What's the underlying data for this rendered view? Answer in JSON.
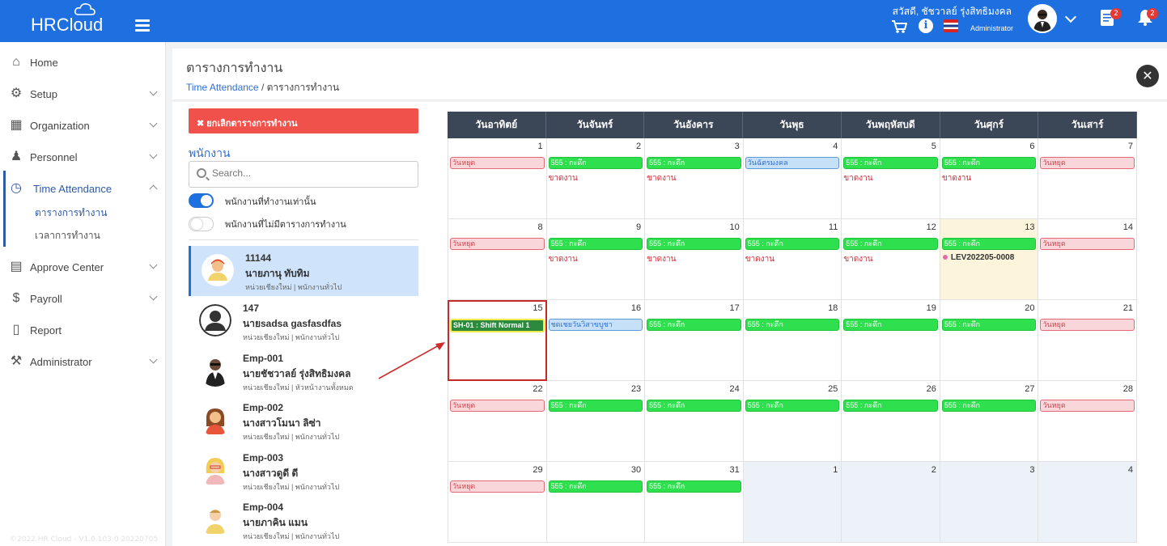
{
  "app": {
    "brand": "HRCloud",
    "greeting": "สวัสดี, ชัชวาลย์ รุ่งสิทธิมงคล",
    "role": "Administrator",
    "doc_badge": "2",
    "bell_badge": "2",
    "icons": [
      "menu-icon",
      "cart-icon",
      "info-icon",
      "flag-icon",
      "document-icon",
      "bell-icon"
    ]
  },
  "sidebar": {
    "items": [
      {
        "label": "Home",
        "icon": "home-icon"
      },
      {
        "label": "Setup",
        "icon": "gear-icon"
      },
      {
        "label": "Organization",
        "icon": "building-icon"
      },
      {
        "label": "Personnel",
        "icon": "people-icon"
      },
      {
        "label": "Time Attendance",
        "icon": "clock-icon"
      },
      {
        "label": "Approve Center",
        "icon": "clipboard-icon"
      },
      {
        "label": "Payroll",
        "icon": "money-bag-icon"
      },
      {
        "label": "Report",
        "icon": "report-icon"
      },
      {
        "label": "Administrator",
        "icon": "tools-icon"
      }
    ],
    "sub_items": [
      "ตารางการทำงาน",
      "เวลาการทำงาน"
    ],
    "footer": "©2022 HR Cloud - V1.0.103.0 20220705"
  },
  "page": {
    "title": "ตารางการทำงาน",
    "crumb_link": "Time Attendance",
    "crumb_current": "/ ตารางการทำงาน"
  },
  "panel": {
    "cancel_button": "✖ ยกเลิกตารางการทำงาน",
    "heading": "พนักงาน",
    "search_placeholder": "Search...",
    "toggle_working": "พนักงานที่ทำงานเท่านั้น",
    "toggle_noschedule": "พนักงานที่ไม่มีตารางการทำงาน",
    "employees": [
      {
        "code": "11144",
        "name": "นายภานุ ทับทิม",
        "meta": "หน่วยเชียงใหม่ | พนักงานทั่วไป"
      },
      {
        "code": "147",
        "name": "นายsadsa gasfasdfas",
        "meta": "หน่วยเชียงใหม่ | พนักงานทั่วไป"
      },
      {
        "code": "Emp-001",
        "name": "นายชัชวาลย์ รุ่งสิทธิมงคล",
        "meta": "หน่วยเชียงใหม่ | หัวหน้างานทั้งหมด"
      },
      {
        "code": "Emp-002",
        "name": "นางสาวโมนา ลิซ่า",
        "meta": "หน่วยเชียงใหม่ | พนักงานทั่วไป"
      },
      {
        "code": "Emp-003",
        "name": "นางสาวดูดี ดี",
        "meta": "หน่วยเชียงใหม่ | พนักงานทั่วไป"
      },
      {
        "code": "Emp-004",
        "name": "นายภาคิน แมน",
        "meta": "หน่วยเชียงใหม่ | พนักงานทั่วไป"
      }
    ]
  },
  "calendar": {
    "weekdays": [
      "วันอาทิตย์",
      "วันจันทร์",
      "วันอังคาร",
      "วันพุธ",
      "วันพฤหัสบดี",
      "วันศุกร์",
      "วันเสาร์"
    ],
    "labels": {
      "holiday": "วันหยุด",
      "shift": "555 : กะดึก",
      "absent": "ขาดงาน",
      "special_1": "วันฉัตรมงคล",
      "special_2": "ชดเชยวันวิสาขบูชา",
      "selected_shift": "SH-01 : Shift Normal 1",
      "leave": "LEV202205-0008"
    },
    "weeks": [
      [
        {
          "day": "1",
          "event": "holiday"
        },
        {
          "day": "2",
          "event": "shift",
          "absent": true
        },
        {
          "day": "3",
          "event": "shift",
          "absent": true
        },
        {
          "day": "4",
          "event": "special_1"
        },
        {
          "day": "5",
          "event": "shift",
          "absent": true
        },
        {
          "day": "6",
          "event": "shift",
          "absent": true
        },
        {
          "day": "7",
          "event": "holiday"
        }
      ],
      [
        {
          "day": "8",
          "event": "holiday"
        },
        {
          "day": "9",
          "event": "shift",
          "absent": true
        },
        {
          "day": "10",
          "event": "shift",
          "absent": true
        },
        {
          "day": "11",
          "event": "shift",
          "absent": true
        },
        {
          "day": "12",
          "event": "shift",
          "absent": true
        },
        {
          "day": "13",
          "event": "shift",
          "leave": true,
          "today": true
        },
        {
          "day": "14",
          "event": "holiday"
        }
      ],
      [
        {
          "day": "15",
          "event": "selected_shift",
          "selected": true
        },
        {
          "day": "16",
          "event": "special_2"
        },
        {
          "day": "17",
          "event": "shift"
        },
        {
          "day": "18",
          "event": "shift"
        },
        {
          "day": "19",
          "event": "shift"
        },
        {
          "day": "20",
          "event": "shift"
        },
        {
          "day": "21",
          "event": "holiday"
        }
      ],
      [
        {
          "day": "22",
          "event": "holiday"
        },
        {
          "day": "23",
          "event": "shift"
        },
        {
          "day": "24",
          "event": "shift"
        },
        {
          "day": "25",
          "event": "shift"
        },
        {
          "day": "26",
          "event": "shift"
        },
        {
          "day": "27",
          "event": "shift"
        },
        {
          "day": "28",
          "event": "holiday"
        }
      ],
      [
        {
          "day": "29",
          "event": "holiday"
        },
        {
          "day": "30",
          "event": "shift"
        },
        {
          "day": "31",
          "event": "shift"
        },
        {
          "day": "1",
          "other": true
        },
        {
          "day": "2",
          "other": true
        },
        {
          "day": "3",
          "other": true
        },
        {
          "day": "4",
          "other": true
        }
      ]
    ]
  },
  "colors": {
    "topbar": "#1e6fe0",
    "shift": "#2ee04e",
    "holiday": "#f9d6d9",
    "cancel": "#f0524b",
    "header": "#3b4657"
  }
}
